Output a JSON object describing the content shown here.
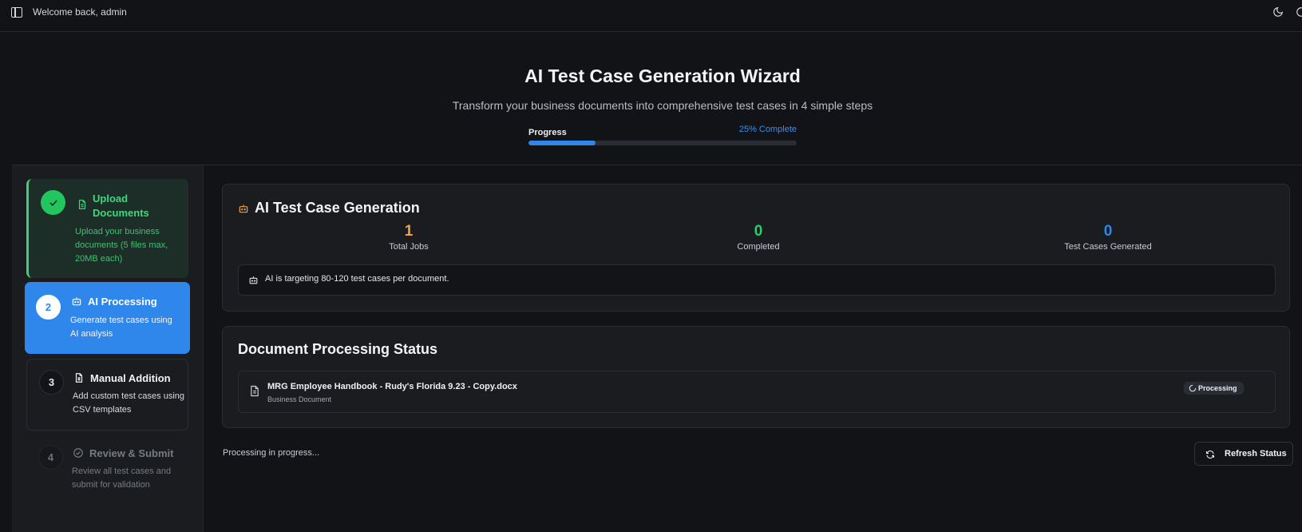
{
  "header": {
    "welcome": "Welcome back, admin",
    "sidebar_toggle_icon": "sidebar-toggle-icon",
    "theme_icon": "moon-icon"
  },
  "hero": {
    "title": "AI Test Case Generation Wizard",
    "subtitle": "Transform your business documents into comprehensive test cases in 4 simple steps",
    "progress_label": "Progress",
    "progress_text": "25% Complete",
    "progress_value": 0.25
  },
  "steps": [
    {
      "number": "✓",
      "title": "Upload Documents",
      "desc": "Upload your business documents (5 files max, 20MB each)",
      "state": "completed",
      "icon": "document-icon"
    },
    {
      "number": "2",
      "title": "AI Processing",
      "desc": "Generate test cases using AI analysis",
      "state": "active",
      "icon": "robot-icon"
    },
    {
      "number": "3",
      "title": "Manual Addition",
      "desc": "Add custom test cases using CSV templates",
      "state": "pending",
      "icon": "spreadsheet-icon"
    },
    {
      "number": "4",
      "title": "Review & Submit",
      "desc": "Review all test cases and submit for validation",
      "state": "disabled",
      "icon": "check-circle-icon"
    }
  ],
  "generation": {
    "title": "AI Test Case Generation",
    "stats": [
      {
        "value": "1",
        "label": "Total Jobs",
        "color": "#f0a343"
      },
      {
        "value": "0",
        "label": "Completed",
        "color": "#2ecc6f"
      },
      {
        "value": "0",
        "label": "Test Cases Generated",
        "color": "#2f86eb"
      }
    ],
    "notice": "AI is targeting 80-120 test cases per document."
  },
  "status": {
    "title": "Document Processing Status",
    "documents": [
      {
        "name": "MRG Employee Handbook - Rudy's Florida 9.23 - Copy.docx",
        "type": "Business Document",
        "status": "Processing"
      }
    ]
  },
  "footer": {
    "progress_text": "Processing in progress...",
    "refresh_label": "Refresh Status"
  },
  "colors": {
    "accent": "#2f86eb",
    "success": "#22c55e",
    "warning": "#f0a343",
    "background": "#111317"
  }
}
